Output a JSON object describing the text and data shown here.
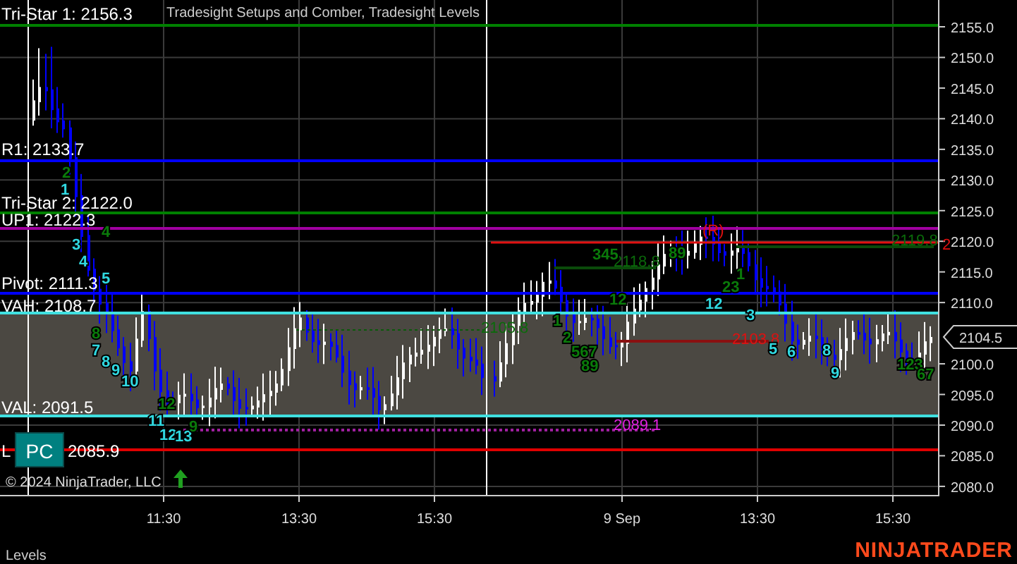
{
  "chart": {
    "title": "Tradesight Setups and Comber, Tradesight Levels",
    "levels": [
      {
        "label": "Tri-Star 1: 2156.3",
        "color": "#008000"
      },
      {
        "label": "R1: 2133.7",
        "color": "#0000ff"
      },
      {
        "label": "Tri-Star 2: 2122.0",
        "color": "#008000"
      },
      {
        "label": "UP1: 2122.3",
        "color": "#a000a0"
      },
      {
        "label": "Pivot: 2111.3",
        "color": "#0000ff"
      },
      {
        "label": "VAH: 2108.7",
        "color": "#40e0e0"
      },
      {
        "label": "VAL: 2091.5",
        "color": "#40e0e0"
      },
      {
        "label": "L",
        "trailing": "2085.9",
        "color": "#e00000"
      }
    ],
    "annotations": [
      {
        "text": "(R)",
        "color": "#e01010"
      },
      {
        "text": "2119.8",
        "color": "#0a6a0a"
      },
      {
        "text": "2118.8",
        "color": "#0a6a0a"
      },
      {
        "text": "2105.8",
        "color": "#0a6a0a"
      },
      {
        "text": "2103.8",
        "color": "#e01010"
      },
      {
        "text": "2089.1",
        "color": "#e020e0"
      }
    ],
    "count_marks": [
      {
        "text": "2",
        "color": "#0a7a0a"
      },
      {
        "text": "1",
        "color": "#30d8e0"
      },
      {
        "text": "4",
        "color": "#0a7a0a"
      },
      {
        "text": "3",
        "color": "#30d8e0"
      },
      {
        "text": "4",
        "color": "#30d8e0"
      },
      {
        "text": "5",
        "color": "#30d8e0"
      },
      {
        "text": "8",
        "color": "#0a7a0a"
      },
      {
        "text": "7",
        "color": "#30d8e0"
      },
      {
        "text": "8",
        "color": "#30d8e0"
      },
      {
        "text": "9",
        "color": "#30d8e0"
      },
      {
        "text": "10",
        "color": "#30d8e0"
      },
      {
        "text": "12",
        "color": "#0a7a0a"
      },
      {
        "text": "11",
        "color": "#30d8e0"
      },
      {
        "text": "12",
        "color": "#30d8e0"
      },
      {
        "text": "13",
        "color": "#30d8e0"
      },
      {
        "text": "9",
        "color": "#0a7a0a"
      },
      {
        "text": "1",
        "color": "#0a7a0a"
      },
      {
        "text": "2",
        "color": "#0a7a0a"
      },
      {
        "text": "567",
        "color": "#0a7a0a"
      },
      {
        "text": "89",
        "color": "#0a7a0a"
      },
      {
        "text": "12",
        "color": "#0a7a0a"
      },
      {
        "text": "345",
        "color": "#0a7a0a"
      },
      {
        "text": "89",
        "color": "#0a7a0a"
      },
      {
        "text": "1",
        "color": "#0a7a0a"
      },
      {
        "text": "23",
        "color": "#0a7a0a"
      },
      {
        "text": "12",
        "color": "#30d8e0"
      },
      {
        "text": "3",
        "color": "#30d8e0"
      },
      {
        "text": "5",
        "color": "#30d8e0"
      },
      {
        "text": "6",
        "color": "#30d8e0"
      },
      {
        "text": "8",
        "color": "#30d8e0"
      },
      {
        "text": "9",
        "color": "#30d8e0"
      },
      {
        "text": "123",
        "color": "#0a7a0a"
      },
      {
        "text": "67",
        "color": "#0a7a0a"
      }
    ],
    "badge": "PC",
    "copyright": "© 2024 NinjaTrader, LLC",
    "current_price": "2104.5",
    "right_mark": "2"
  },
  "price_axis": {
    "ticks": [
      "2155.0",
      "2150.0",
      "2145.0",
      "2140.0",
      "2135.0",
      "2130.0",
      "2125.0",
      "2120.0",
      "2115.0",
      "2110.0",
      "2100.0",
      "2095.0",
      "2090.0",
      "2085.0",
      "2080.0"
    ]
  },
  "time_axis": {
    "ticks": [
      "11:30",
      "13:30",
      "15:30",
      "9 Sep",
      "13:30",
      "15:30"
    ]
  },
  "footer": {
    "panel_label": "Levels",
    "logo": "NINJATRADER"
  }
}
